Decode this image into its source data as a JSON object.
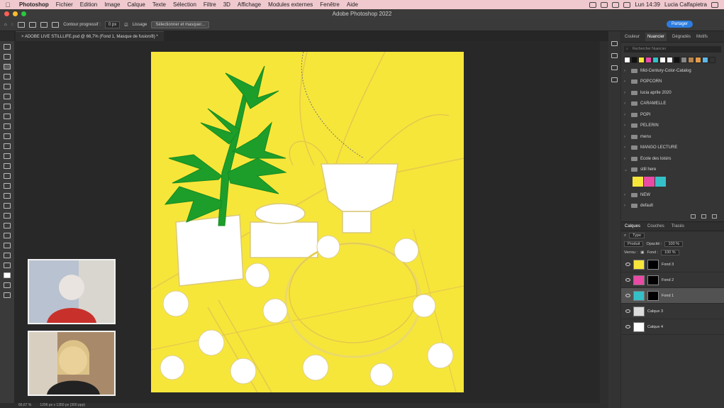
{
  "menubar": {
    "app": "Photoshop",
    "items": [
      "Fichier",
      "Edition",
      "Image",
      "Calque",
      "Texte",
      "Sélection",
      "Filtre",
      "3D",
      "Affichage",
      "Modules externes",
      "Fenêtre",
      "Aide"
    ],
    "clock": "Lun 14:39",
    "user": "Lucia Calfapietra"
  },
  "window": {
    "title": "Adobe Photoshop 2022"
  },
  "options": {
    "feather_label": "Contour progressif :",
    "feather_value": "0 px",
    "smooth_label": "Lissage",
    "select_mask_label": "Sélectionner et masquer...",
    "share_label": "Partager"
  },
  "document": {
    "tab": "ADOBE LIVE STILLLIFE.psd @ 66,7% (Fond 1, Masque de fusion/8) *"
  },
  "status": {
    "zoom": "66,67 %",
    "size": "1296 px x 1350 px (300 ppp)"
  },
  "swatches_panel": {
    "tabs": [
      "Couleur",
      "Nuancier",
      "Dégradés",
      "Motifs"
    ],
    "active_tab": "Nuancier",
    "search_placeholder": "Rechercher Nuancier",
    "recent_colors": [
      "#ffffff",
      "#111111",
      "#f7e63a",
      "#e94aa5",
      "#35c0c8",
      "#ffffff",
      "#f3f3f3",
      "#111111",
      "#888888",
      "#b8854f",
      "#e59a48",
      "#5db7e8",
      "#333333"
    ],
    "folders": [
      {
        "name": "Mid-Century-Color-Catalog"
      },
      {
        "name": "POPCORN"
      },
      {
        "name": "lucia aprile 2020"
      },
      {
        "name": "CARAMELLE"
      },
      {
        "name": "POPI"
      },
      {
        "name": "PELERIN"
      },
      {
        "name": "menu"
      },
      {
        "name": "MANGO LECTURE"
      },
      {
        "name": "Ecole des loisirs"
      },
      {
        "name": "still here"
      }
    ],
    "group_colors": [
      "#f7e63a",
      "#e94aa5",
      "#35c0c8"
    ],
    "folders_after": [
      {
        "name": "NEW"
      },
      {
        "name": "default"
      }
    ]
  },
  "layers_panel": {
    "tabs": [
      "Calques",
      "Couches",
      "Tracés"
    ],
    "active_tab": "Calques",
    "filter": "Type",
    "blend_mode": "Produit",
    "opacity_label": "Opacité :",
    "opacity": "100 %",
    "lock_label": "Verrou :",
    "fill_label": "Fond :",
    "fill": "100 %",
    "layers": [
      {
        "name": "Fond 3",
        "color": "#f7e63a",
        "mask": true,
        "active": false
      },
      {
        "name": "Fond 2",
        "color": "#e94aa5",
        "mask": true,
        "active": false
      },
      {
        "name": "Fond 1",
        "color": "#35c0c8",
        "mask": true,
        "active": true
      },
      {
        "name": "Calque 3",
        "color": "#dcdcdc",
        "mask": false,
        "active": false
      },
      {
        "name": "Calque 4",
        "color": "#ffffff",
        "mask": false,
        "active": false
      }
    ]
  },
  "colors": {
    "canvas_bg": "#f7e63a",
    "plant_green": "#1d9e2a",
    "accent_blue": "#2d7de0"
  }
}
